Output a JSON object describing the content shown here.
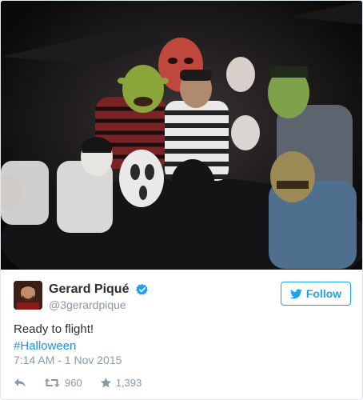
{
  "tweet": {
    "display_name": "Gerard Piqué",
    "handle": "@3gerardpique",
    "follow_label": "Follow",
    "text_line1": "Ready to flight!",
    "hashtag": "#Halloween",
    "timestamp": "7:14 AM - 1 Nov 2015",
    "retweet_count": "960",
    "like_count": "1,393"
  },
  "colors": {
    "brand_blue": "#1da1f2",
    "link_blue": "#1b95e0",
    "muted_gray": "#8899a6",
    "text_dark": "#292f33"
  },
  "icons": {
    "verified": "verified-badge-icon",
    "follow": "twitter-bird-icon",
    "reply": "reply-arrow-icon",
    "retweet": "retweet-icon",
    "like": "star-icon"
  }
}
